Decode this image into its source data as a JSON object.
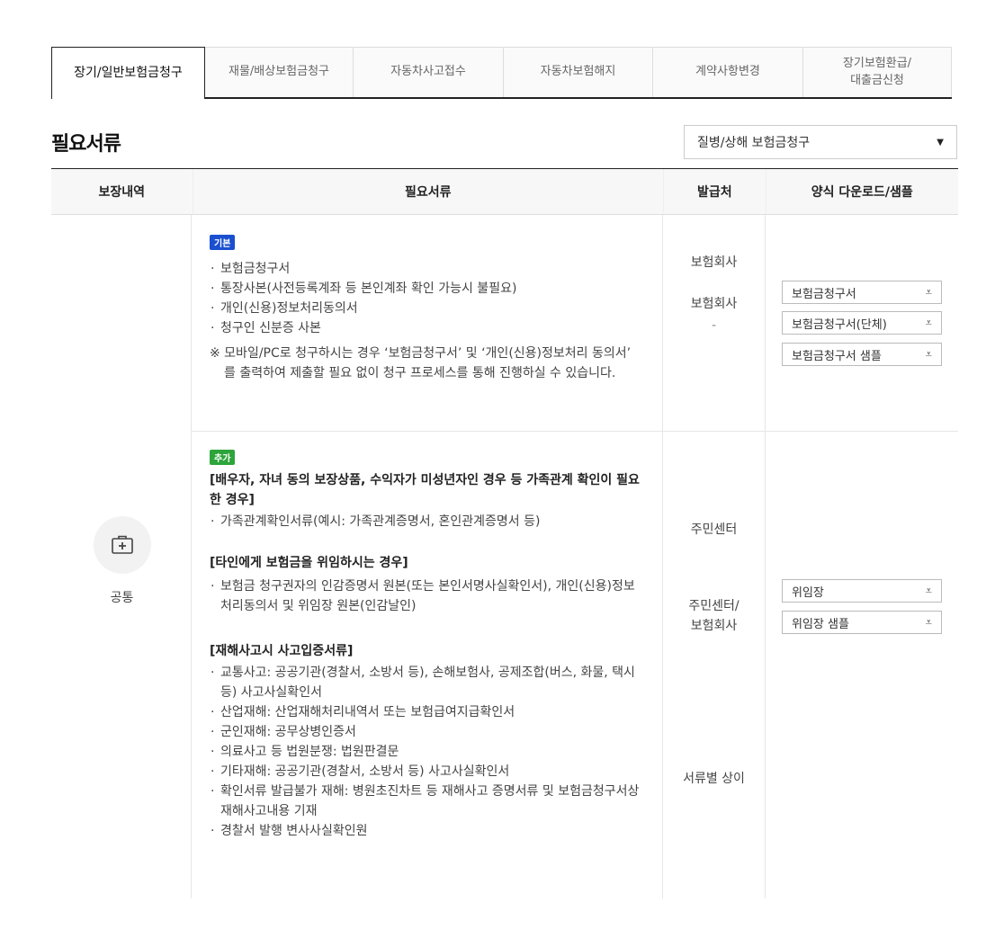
{
  "tabs": [
    {
      "label": "장기/일반보험금청구",
      "active": true
    },
    {
      "label": "재물/배상보험금청구"
    },
    {
      "label": "자동차사고접수"
    },
    {
      "label": "자동차보험해지"
    },
    {
      "label": "계약사항변경"
    },
    {
      "label": "장기보험환급/\n대출금신청"
    }
  ],
  "page_title": "필요서류",
  "claim_select": {
    "value": "질병/상해 보험금청구"
  },
  "table": {
    "headers": [
      "보장내역",
      "필요서류",
      "발급처",
      "양식 다운로드/샘플"
    ],
    "coverage": {
      "label": "공통",
      "icon": "medical-kit-icon"
    },
    "basic": {
      "badge": "기본",
      "items": [
        "보험금청구서",
        "통장사본(사전등록계좌 등 본인계좌 확인 가능시 불필요)",
        "개인(신용)정보처리동의서",
        "청구인 신분증 사본"
      ],
      "note": "※ 모바일/PC로 청구하시는 경우 ‘보험금청구서’ 및 ‘개인(신용)정보처리 동의서’ 를 출력하여 제출할 필요 없이 청구 프로세스를 통해 진행하실 수 있습니다.",
      "issuers": [
        "보험회사",
        "보험회사",
        "-"
      ],
      "downloads": [
        "보험금청구서",
        "보험금청구서(단체)",
        "보험금청구서 샘플"
      ]
    },
    "additional": {
      "badge": "추가",
      "groups": [
        {
          "title": "[배우자, 자녀 동의 보장상품, 수익자가 미성년자인 경우 등 가족관계 확인이 필요한 경우]",
          "items": [
            "가족관계확인서류(예시: 가족관계증명서, 혼인관계증명서 등)"
          ],
          "issuer": "주민센터"
        },
        {
          "title": "[타인에게 보험금을 위임하시는 경우]",
          "items": [
            "보험금 청구권자의 인감증명서 원본(또는 본인서명사실확인서), 개인(신용)정보처리동의서 및 위임장 원본(인감날인)"
          ],
          "issuer": "주민센터/\n보험회사"
        },
        {
          "title": "[재해사고시 사고입증서류]",
          "items": [
            "교통사고: 공공기관(경찰서, 소방서 등), 손해보험사, 공제조합(버스, 화물, 택시 등) 사고사실확인서",
            "산업재해: 산업재해처리내역서 또는 보험급여지급확인서",
            "군인재해: 공무상병인증서",
            "의료사고 등 법원분쟁: 법원판결문",
            "기타재해: 공공기관(경찰서, 소방서 등) 사고사실확인서",
            "확인서류 발급불가 재해: 병원초진차트 등 재해사고 증명서류 및 보험금청구서상 재해사고내용 기재",
            "경찰서 발행 변사사실확인원"
          ],
          "issuer": "서류별 상이"
        }
      ],
      "downloads": [
        "위임장",
        "위임장 샘플"
      ]
    }
  },
  "download_glyph": "⩡"
}
